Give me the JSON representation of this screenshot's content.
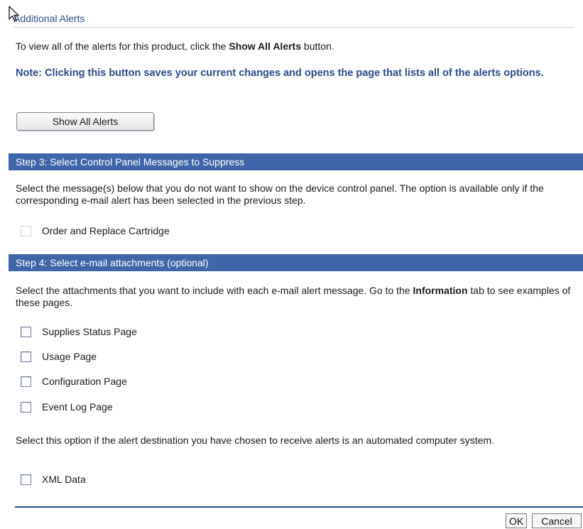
{
  "section": {
    "title": "Additional Alerts"
  },
  "intro": {
    "prefix": "To view all of the alerts for this product, click the ",
    "bold": "Show All Alerts",
    "suffix": " button."
  },
  "note": "Note: Clicking this button saves your current changes and opens the page that lists all of the alerts options.",
  "show_all_button": "Show All Alerts",
  "step3": {
    "title": "Step 3: Select Control Panel Messages to Suppress",
    "description": "Select the message(s) below that you do not want to show on the device control panel. The option is available only if the corresponding e-mail alert has been selected in the previous step.",
    "options": [
      {
        "label": "Order and Replace Cartridge",
        "checked": false,
        "disabled": true
      }
    ]
  },
  "step4": {
    "title": "Step 4: Select e-mail attachments (optional)",
    "description_prefix": "Select the attachments that you want to include with each e-mail alert message. Go to the ",
    "description_bold": "Information",
    "description_suffix": " tab to see examples of these pages.",
    "options": [
      {
        "label": "Supplies Status Page",
        "checked": false
      },
      {
        "label": "Usage Page",
        "checked": false
      },
      {
        "label": "Configuration Page",
        "checked": false
      },
      {
        "label": "Event Log Page",
        "checked": false
      }
    ],
    "automated_description": "Select this option if the alert destination you have chosen to receive alerts is an automated computer system.",
    "xml_option": {
      "label": "XML Data",
      "checked": false
    }
  },
  "footer": {
    "ok_label": "OK",
    "cancel_label": "Cancel"
  },
  "colors": {
    "step_bar": "#3f66a8",
    "title": "#2f4f8f",
    "note": "#2a4a8a"
  },
  "icons": {
    "cursor": "arrow-cursor-icon"
  }
}
